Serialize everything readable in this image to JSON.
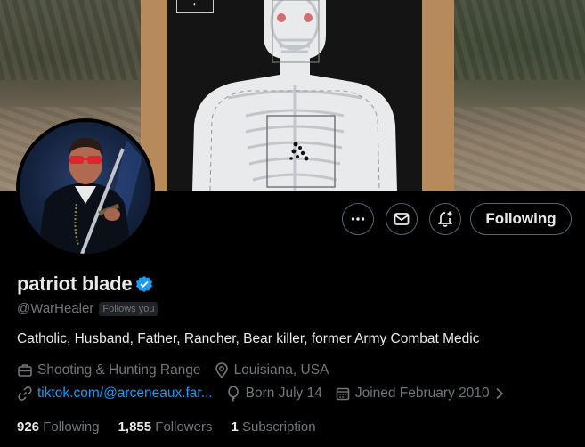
{
  "profile": {
    "display_name": "patriot blade",
    "handle": "@WarHealer",
    "follows_you": "Follows you",
    "bio": "Catholic, Husband, Father, Rancher, Bear killer, former Army Combat Medic",
    "category": "Shooting & Hunting Range",
    "location": "Louisiana, USA",
    "website": "tiktok.com/@arceneaux.far...",
    "birthday": "Born July 14",
    "joined": "Joined February 2010"
  },
  "actions": {
    "follow_label": "Following"
  },
  "stats": {
    "following_count": "926",
    "following_label": "Following",
    "followers_count": "1,855",
    "followers_label": "Followers",
    "subscription_count": "1",
    "subscription_label": "Subscription"
  },
  "colors": {
    "accent": "#1d9bf0",
    "background": "#000000",
    "muted_text": "#71767b",
    "primary_text": "#e7e9ea",
    "border": "#536471"
  },
  "icons": [
    "more-icon",
    "message-icon",
    "notification-bell-icon",
    "verified-badge-icon",
    "briefcase-icon",
    "location-pin-icon",
    "link-icon",
    "birthday-balloon-icon",
    "calendar-icon",
    "chevron-right-icon"
  ]
}
